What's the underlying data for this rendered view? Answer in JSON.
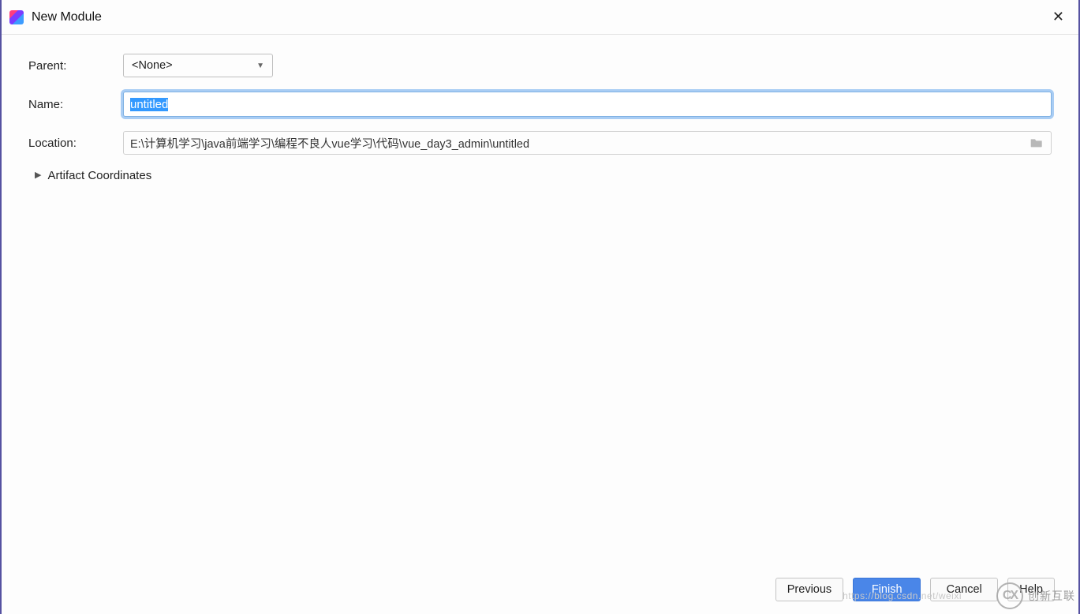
{
  "window": {
    "title": "New Module"
  },
  "form": {
    "parent": {
      "label": "Parent:",
      "selected": "<None>"
    },
    "name": {
      "label": "Name:",
      "value": "untitled"
    },
    "location": {
      "label": "Location:",
      "value": "E:\\计算机学习\\java前端学习\\编程不良人vue学习\\代码\\vue_day3_admin\\untitled"
    },
    "artifact_section": "Artifact Coordinates"
  },
  "buttons": {
    "previous": "Previous",
    "finish": "Finish",
    "cancel": "Cancel",
    "help": "Help"
  },
  "watermark": {
    "brand": "创新互联",
    "url": "https://blog.csdn.net/weixi"
  }
}
